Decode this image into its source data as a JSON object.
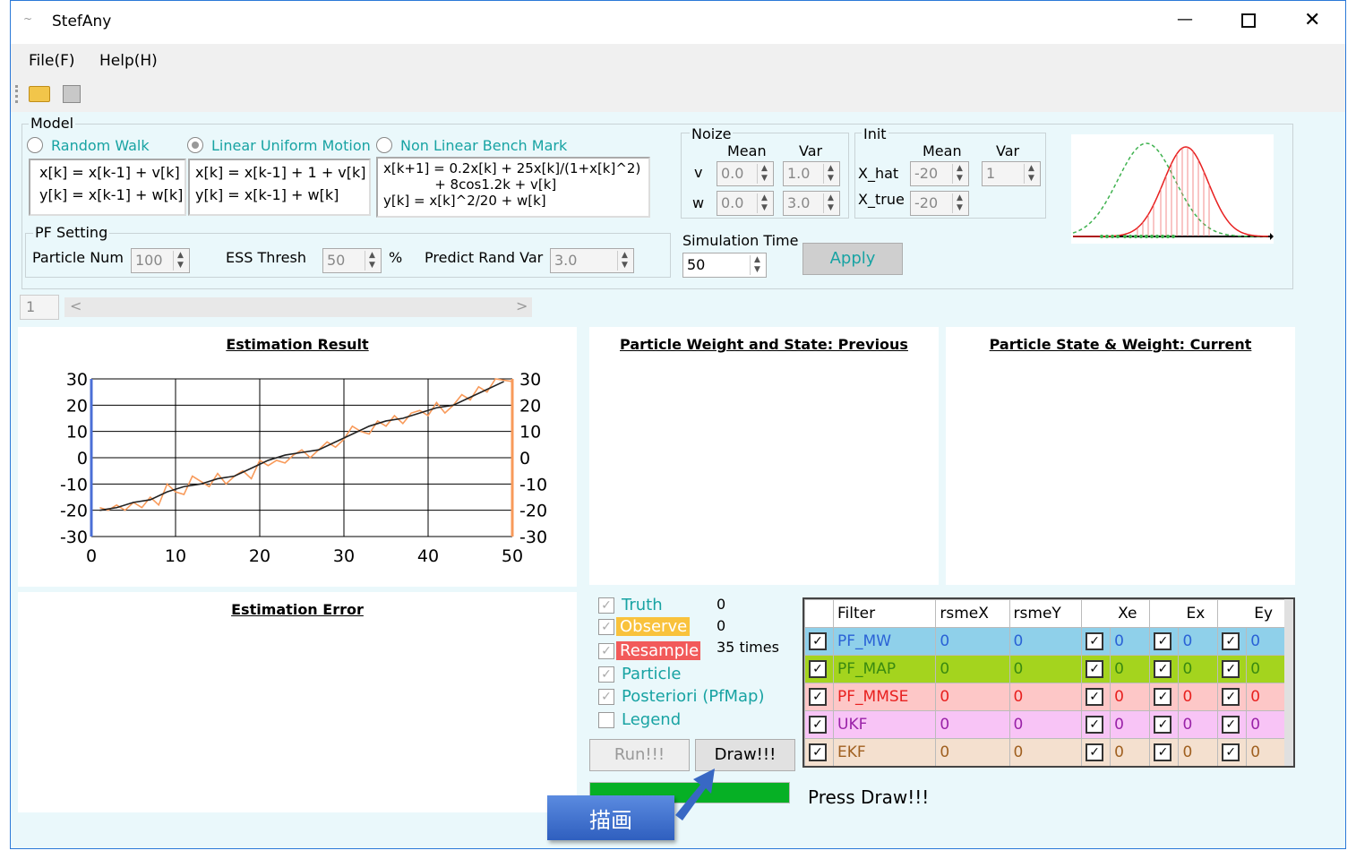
{
  "window": {
    "title": "StefAny",
    "minimize_glyph": "—",
    "maximize_glyph": "☐",
    "close_glyph": "✕"
  },
  "menu": {
    "file": "File(F)",
    "help": "Help(H)"
  },
  "toolbar": {
    "open_icon": "folder-open-icon",
    "save_icon": "save-icon"
  },
  "model": {
    "group_label": "Model",
    "options": [
      "Random Walk",
      "Linear Uniform Motion",
      "Non Linear Bench Mark"
    ],
    "selected": "Linear Uniform Motion",
    "eq_random_walk": "x[k] = x[k-1] + v[k]\ny[k] = x[k-1] + w[k]",
    "eq_linear": "x[k] = x[k-1] + 1 + v[k]\ny[k] = x[k-1] + w[k]",
    "eq_nonlinear": "x[k+1] = 0.2x[k] + 25x[k]/(1+x[k]^2)\n            + 8cos1.2k + v[k]\ny[k] = x[k]^2/20 + w[k]"
  },
  "noize": {
    "label": "Noize",
    "mean_header": "Mean",
    "var_header": "Var",
    "v_label": "v",
    "w_label": "w",
    "v_mean": "0.0",
    "v_var": "1.0",
    "w_mean": "0.0",
    "w_var": "3.0"
  },
  "init": {
    "label": "Init",
    "mean_header": "Mean",
    "var_header": "Var",
    "xhat_label": "X_hat",
    "xtrue_label": "X_true",
    "xhat_mean": "-20",
    "xhat_var": "1",
    "xtrue_mean": "-20"
  },
  "pf": {
    "label": "PF Setting",
    "particle_num_label": "Particle Num",
    "particle_num": "100",
    "ess_label": "ESS Thresh",
    "ess_value": "50",
    "ess_unit": "%",
    "predict_label": "Predict Rand Var",
    "predict_value": "3.0"
  },
  "sim": {
    "label": "Simulation Time",
    "value": "50",
    "apply": "Apply"
  },
  "slider": {
    "value": "1",
    "left_arrow": "<",
    "right_arrow": ">"
  },
  "panels": {
    "estimation_result": "Estimation Result",
    "estimation_error": "Estimation Error",
    "prev": "Particle Weight and State: Previous",
    "curr": "Particle State & Weight: Current"
  },
  "checks": [
    {
      "label": "Truth",
      "checked": true,
      "count": "0"
    },
    {
      "label": "Observe",
      "checked": true,
      "count": "0",
      "bg": "#f9c23c",
      "fg": "#fff"
    },
    {
      "label": "Resample",
      "checked": true,
      "count": "35 times",
      "bg": "#f25a5a",
      "fg": "#fff"
    },
    {
      "label": "Particle",
      "checked": true
    },
    {
      "label": "Posteriori (PfMap)",
      "checked": true
    },
    {
      "label": "Legend",
      "checked": false
    }
  ],
  "buttons": {
    "run": "Run!!!",
    "draw": "Draw!!!"
  },
  "status": {
    "message": "Press Draw!!!",
    "progress": 1.0,
    "progress_color": "#06b025"
  },
  "callout": {
    "text": "描画",
    "color": "#3868c4"
  },
  "grid": {
    "headers": [
      "Filter",
      "rsmeX",
      "rsmeY",
      "Xe",
      "Ex",
      "Ey"
    ],
    "rows": [
      {
        "name": "PF_MW",
        "rsmeX": "0",
        "rsmeY": "0",
        "xe": "0",
        "ex": "0",
        "ey": "0",
        "bg": "#8fd0ea",
        "fg": "#2a62d6"
      },
      {
        "name": "PF_MAP",
        "rsmeX": "0",
        "rsmeY": "0",
        "xe": "0",
        "ex": "0",
        "ey": "0",
        "bg": "#a4d41e",
        "fg": "#3a8a10"
      },
      {
        "name": "PF_MMSE",
        "rsmeX": "0",
        "rsmeY": "0",
        "xe": "0",
        "ex": "0",
        "ey": "0",
        "bg": "#fdc7c7",
        "fg": "#e8201f"
      },
      {
        "name": "UKF",
        "rsmeX": "0",
        "rsmeY": "0",
        "xe": "0",
        "ex": "0",
        "ey": "0",
        "bg": "#f8c4f6",
        "fg": "#9a22a8"
      },
      {
        "name": "EKF",
        "rsmeX": "0",
        "rsmeY": "0",
        "xe": "0",
        "ex": "0",
        "ey": "0",
        "bg": "#f4e0cf",
        "fg": "#a06020"
      }
    ]
  },
  "chart_data": {
    "type": "line",
    "title": "Estimation Result",
    "xlim": [
      0,
      50
    ],
    "ylim": [
      -30,
      30
    ],
    "xticks": [
      0,
      10,
      20,
      30,
      40,
      50
    ],
    "yticks": [
      30,
      20,
      10,
      0,
      -10,
      -20,
      -30
    ],
    "grid": true,
    "series": [
      {
        "color": "#222222",
        "values": [
          [
            1,
            -20
          ],
          [
            3,
            -19
          ],
          [
            5,
            -17
          ],
          [
            7,
            -16
          ],
          [
            9,
            -13
          ],
          [
            11,
            -11
          ],
          [
            13,
            -10
          ],
          [
            15,
            -8
          ],
          [
            17,
            -7
          ],
          [
            19,
            -4
          ],
          [
            21,
            -1
          ],
          [
            23,
            1
          ],
          [
            25,
            2
          ],
          [
            27,
            3
          ],
          [
            29,
            6
          ],
          [
            31,
            9
          ],
          [
            33,
            12
          ],
          [
            35,
            14
          ],
          [
            37,
            15
          ],
          [
            39,
            17
          ],
          [
            41,
            19
          ],
          [
            43,
            20
          ],
          [
            45,
            23
          ],
          [
            47,
            26
          ],
          [
            49,
            29
          ]
        ]
      },
      {
        "color": "#f89a5a",
        "values": [
          [
            1,
            -19
          ],
          [
            2,
            -20
          ],
          [
            3,
            -18
          ],
          [
            4,
            -20
          ],
          [
            5,
            -17
          ],
          [
            6,
            -19
          ],
          [
            7,
            -15
          ],
          [
            8,
            -18
          ],
          [
            9,
            -10
          ],
          [
            10,
            -13
          ],
          [
            11,
            -14
          ],
          [
            12,
            -7
          ],
          [
            13,
            -9
          ],
          [
            14,
            -11
          ],
          [
            15,
            -6
          ],
          [
            16,
            -10
          ],
          [
            17,
            -7
          ],
          [
            18,
            -5
          ],
          [
            19,
            -8
          ],
          [
            20,
            -1
          ],
          [
            21,
            -3
          ],
          [
            22,
            -1
          ],
          [
            23,
            -2
          ],
          [
            24,
            1
          ],
          [
            25,
            3
          ],
          [
            26,
            0
          ],
          [
            27,
            3
          ],
          [
            28,
            6
          ],
          [
            29,
            4
          ],
          [
            30,
            7
          ],
          [
            31,
            12
          ],
          [
            32,
            10
          ],
          [
            33,
            9
          ],
          [
            34,
            14
          ],
          [
            35,
            12
          ],
          [
            36,
            16
          ],
          [
            37,
            13
          ],
          [
            38,
            17
          ],
          [
            39,
            18
          ],
          [
            40,
            16
          ],
          [
            41,
            21
          ],
          [
            42,
            17
          ],
          [
            43,
            20
          ],
          [
            44,
            24
          ],
          [
            45,
            22
          ],
          [
            46,
            27
          ],
          [
            47,
            25
          ],
          [
            48,
            30
          ],
          [
            49,
            31
          ],
          [
            50,
            29
          ]
        ]
      }
    ]
  }
}
